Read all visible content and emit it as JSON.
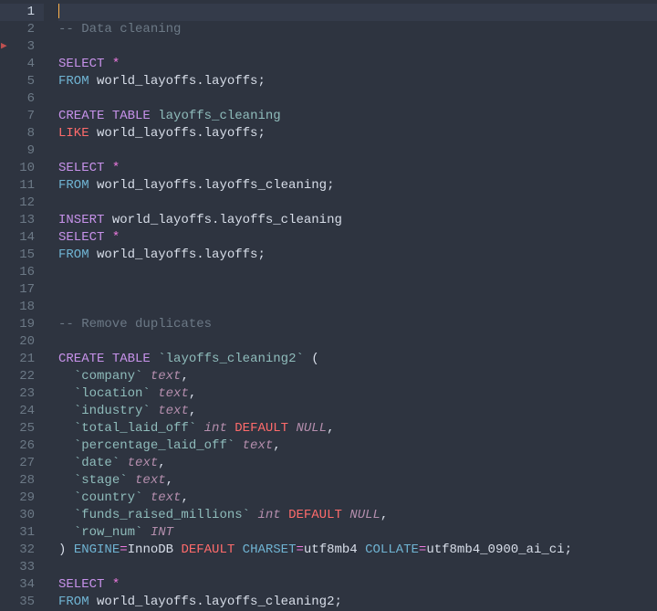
{
  "editor": {
    "current_line": 1,
    "lines": [
      {
        "n": 1,
        "t": []
      },
      {
        "n": 2,
        "t": [
          [
            "c",
            "-- Data cleaning"
          ]
        ]
      },
      {
        "n": 3,
        "t": []
      },
      {
        "n": 4,
        "t": [
          [
            "k",
            "SELECT"
          ],
          [
            "nm",
            " "
          ],
          [
            "op",
            "*"
          ]
        ]
      },
      {
        "n": 5,
        "t": [
          [
            "kb",
            "FROM"
          ],
          [
            "nm",
            " world_layoffs"
          ],
          [
            "pn",
            "."
          ],
          [
            "nm",
            "layoffs"
          ],
          [
            "pn",
            ";"
          ]
        ]
      },
      {
        "n": 6,
        "t": []
      },
      {
        "n": 7,
        "t": [
          [
            "k",
            "CREATE"
          ],
          [
            "nm",
            " "
          ],
          [
            "k",
            "TABLE"
          ],
          [
            "nm",
            " "
          ],
          [
            "tk",
            "layoffs_cleaning"
          ]
        ]
      },
      {
        "n": 8,
        "t": [
          [
            "kr",
            "LIKE"
          ],
          [
            "nm",
            " world_layoffs"
          ],
          [
            "pn",
            "."
          ],
          [
            "nm",
            "layoffs"
          ],
          [
            "pn",
            ";"
          ]
        ]
      },
      {
        "n": 9,
        "t": []
      },
      {
        "n": 10,
        "t": [
          [
            "k",
            "SELECT"
          ],
          [
            "nm",
            " "
          ],
          [
            "op",
            "*"
          ]
        ]
      },
      {
        "n": 11,
        "t": [
          [
            "kb",
            "FROM"
          ],
          [
            "nm",
            " world_layoffs"
          ],
          [
            "pn",
            "."
          ],
          [
            "nm",
            "layoffs_cleaning"
          ],
          [
            "pn",
            ";"
          ]
        ]
      },
      {
        "n": 12,
        "t": []
      },
      {
        "n": 13,
        "t": [
          [
            "k",
            "INSERT"
          ],
          [
            "nm",
            " world_layoffs"
          ],
          [
            "pn",
            "."
          ],
          [
            "nm",
            "layoffs_cleaning"
          ]
        ]
      },
      {
        "n": 14,
        "t": [
          [
            "k",
            "SELECT"
          ],
          [
            "nm",
            " "
          ],
          [
            "op",
            "*"
          ]
        ]
      },
      {
        "n": 15,
        "t": [
          [
            "kb",
            "FROM"
          ],
          [
            "nm",
            " world_layoffs"
          ],
          [
            "pn",
            "."
          ],
          [
            "nm",
            "layoffs"
          ],
          [
            "pn",
            ";"
          ]
        ]
      },
      {
        "n": 16,
        "t": []
      },
      {
        "n": 17,
        "t": []
      },
      {
        "n": 18,
        "t": []
      },
      {
        "n": 19,
        "t": [
          [
            "c",
            "-- Remove duplicates"
          ]
        ]
      },
      {
        "n": 20,
        "t": []
      },
      {
        "n": 21,
        "t": [
          [
            "k",
            "CREATE"
          ],
          [
            "nm",
            " "
          ],
          [
            "k",
            "TABLE"
          ],
          [
            "nm",
            " "
          ],
          [
            "tk",
            "`layoffs_cleaning2`"
          ],
          [
            "nm",
            " "
          ],
          [
            "pn",
            "("
          ]
        ]
      },
      {
        "n": 22,
        "t": [
          [
            "nm",
            "  "
          ],
          [
            "tk",
            "`company`"
          ],
          [
            "nm",
            " "
          ],
          [
            "dt",
            "text"
          ],
          [
            "pn",
            ","
          ]
        ]
      },
      {
        "n": 23,
        "t": [
          [
            "nm",
            "  "
          ],
          [
            "tk",
            "`location`"
          ],
          [
            "nm",
            " "
          ],
          [
            "dt",
            "text"
          ],
          [
            "pn",
            ","
          ]
        ]
      },
      {
        "n": 24,
        "t": [
          [
            "nm",
            "  "
          ],
          [
            "tk",
            "`industry`"
          ],
          [
            "nm",
            " "
          ],
          [
            "dt",
            "text"
          ],
          [
            "pn",
            ","
          ]
        ]
      },
      {
        "n": 25,
        "t": [
          [
            "nm",
            "  "
          ],
          [
            "tk",
            "`total_laid_off`"
          ],
          [
            "nm",
            " "
          ],
          [
            "dt",
            "int"
          ],
          [
            "nm",
            " "
          ],
          [
            "kr",
            "DEFAULT"
          ],
          [
            "nm",
            " "
          ],
          [
            "nl",
            "NULL"
          ],
          [
            "pn",
            ","
          ]
        ]
      },
      {
        "n": 26,
        "t": [
          [
            "nm",
            "  "
          ],
          [
            "tk",
            "`percentage_laid_off`"
          ],
          [
            "nm",
            " "
          ],
          [
            "dt",
            "text"
          ],
          [
            "pn",
            ","
          ]
        ]
      },
      {
        "n": 27,
        "t": [
          [
            "nm",
            "  "
          ],
          [
            "tk",
            "`date`"
          ],
          [
            "nm",
            " "
          ],
          [
            "dt",
            "text"
          ],
          [
            "pn",
            ","
          ]
        ]
      },
      {
        "n": 28,
        "t": [
          [
            "nm",
            "  "
          ],
          [
            "tk",
            "`stage`"
          ],
          [
            "nm",
            " "
          ],
          [
            "dt",
            "text"
          ],
          [
            "pn",
            ","
          ]
        ]
      },
      {
        "n": 29,
        "t": [
          [
            "nm",
            "  "
          ],
          [
            "tk",
            "`country`"
          ],
          [
            "nm",
            " "
          ],
          [
            "dt",
            "text"
          ],
          [
            "pn",
            ","
          ]
        ]
      },
      {
        "n": 30,
        "t": [
          [
            "nm",
            "  "
          ],
          [
            "tk",
            "`funds_raised_millions`"
          ],
          [
            "nm",
            " "
          ],
          [
            "dt",
            "int"
          ],
          [
            "nm",
            " "
          ],
          [
            "kr",
            "DEFAULT"
          ],
          [
            "nm",
            " "
          ],
          [
            "nl",
            "NULL"
          ],
          [
            "pn",
            ","
          ]
        ]
      },
      {
        "n": 31,
        "t": [
          [
            "nm",
            "  "
          ],
          [
            "tk",
            "`row_num`"
          ],
          [
            "nm",
            " "
          ],
          [
            "dt",
            "INT"
          ]
        ]
      },
      {
        "n": 32,
        "t": [
          [
            "pn",
            ")"
          ],
          [
            "nm",
            " "
          ],
          [
            "kb",
            "ENGINE"
          ],
          [
            "op",
            "="
          ],
          [
            "nm",
            "InnoDB "
          ],
          [
            "kr",
            "DEFAULT"
          ],
          [
            "nm",
            " "
          ],
          [
            "kb",
            "CHARSET"
          ],
          [
            "op",
            "="
          ],
          [
            "nm",
            "utf8mb4 "
          ],
          [
            "kb",
            "COLLATE"
          ],
          [
            "op",
            "="
          ],
          [
            "nm",
            "utf8mb4_0900_ai_ci"
          ],
          [
            "pn",
            ";"
          ]
        ]
      },
      {
        "n": 33,
        "t": []
      },
      {
        "n": 34,
        "t": [
          [
            "k",
            "SELECT"
          ],
          [
            "nm",
            " "
          ],
          [
            "op",
            "*"
          ]
        ]
      },
      {
        "n": 35,
        "t": [
          [
            "kb",
            "FROM"
          ],
          [
            "nm",
            " world_layoffs"
          ],
          [
            "pn",
            "."
          ],
          [
            "nm",
            "layoffs_cleaning2"
          ],
          [
            "pn",
            ";"
          ]
        ]
      }
    ]
  }
}
